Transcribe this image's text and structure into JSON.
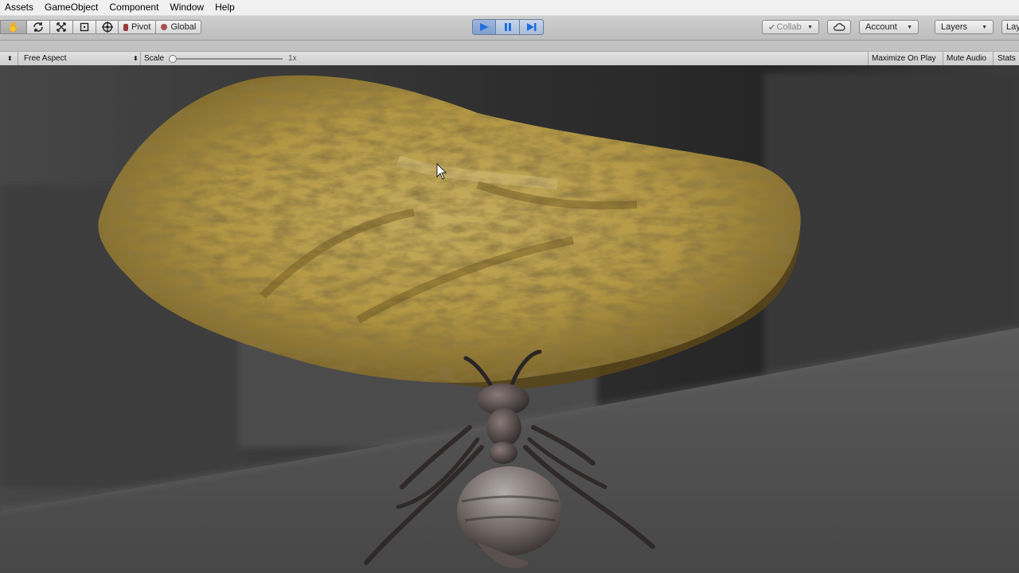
{
  "menu": [
    "Assets",
    "GameObject",
    "Component",
    "Window",
    "Help"
  ],
  "toolbar": {
    "tools": [
      {
        "icon": "hand-tool-icon",
        "glyph": "✋"
      },
      {
        "icon": "rotate-tool-icon",
        "glyph": "⟳"
      },
      {
        "icon": "scale-tool-icon",
        "glyph": "⤧"
      },
      {
        "icon": "rect-tool-icon",
        "glyph": "▣"
      },
      {
        "icon": "transform-tool-icon",
        "glyph": "⊕"
      }
    ],
    "pivot_label": "Pivot",
    "global_label": "Global",
    "collab_label": "Collab",
    "account_label": "Account",
    "layers_label": "Layers",
    "layout_label": "Lay"
  },
  "game_view": {
    "aspect_label": "Free Aspect",
    "scale_label": "Scale",
    "scale_value": "1x",
    "maximize_label": "Maximize On Play",
    "mute_label": "Mute Audio",
    "stats_label": "Stats"
  },
  "colors": {
    "play_accent": "#1f6fe0",
    "chip_color": "#b49a4c",
    "ant_color": "#3a3232"
  }
}
